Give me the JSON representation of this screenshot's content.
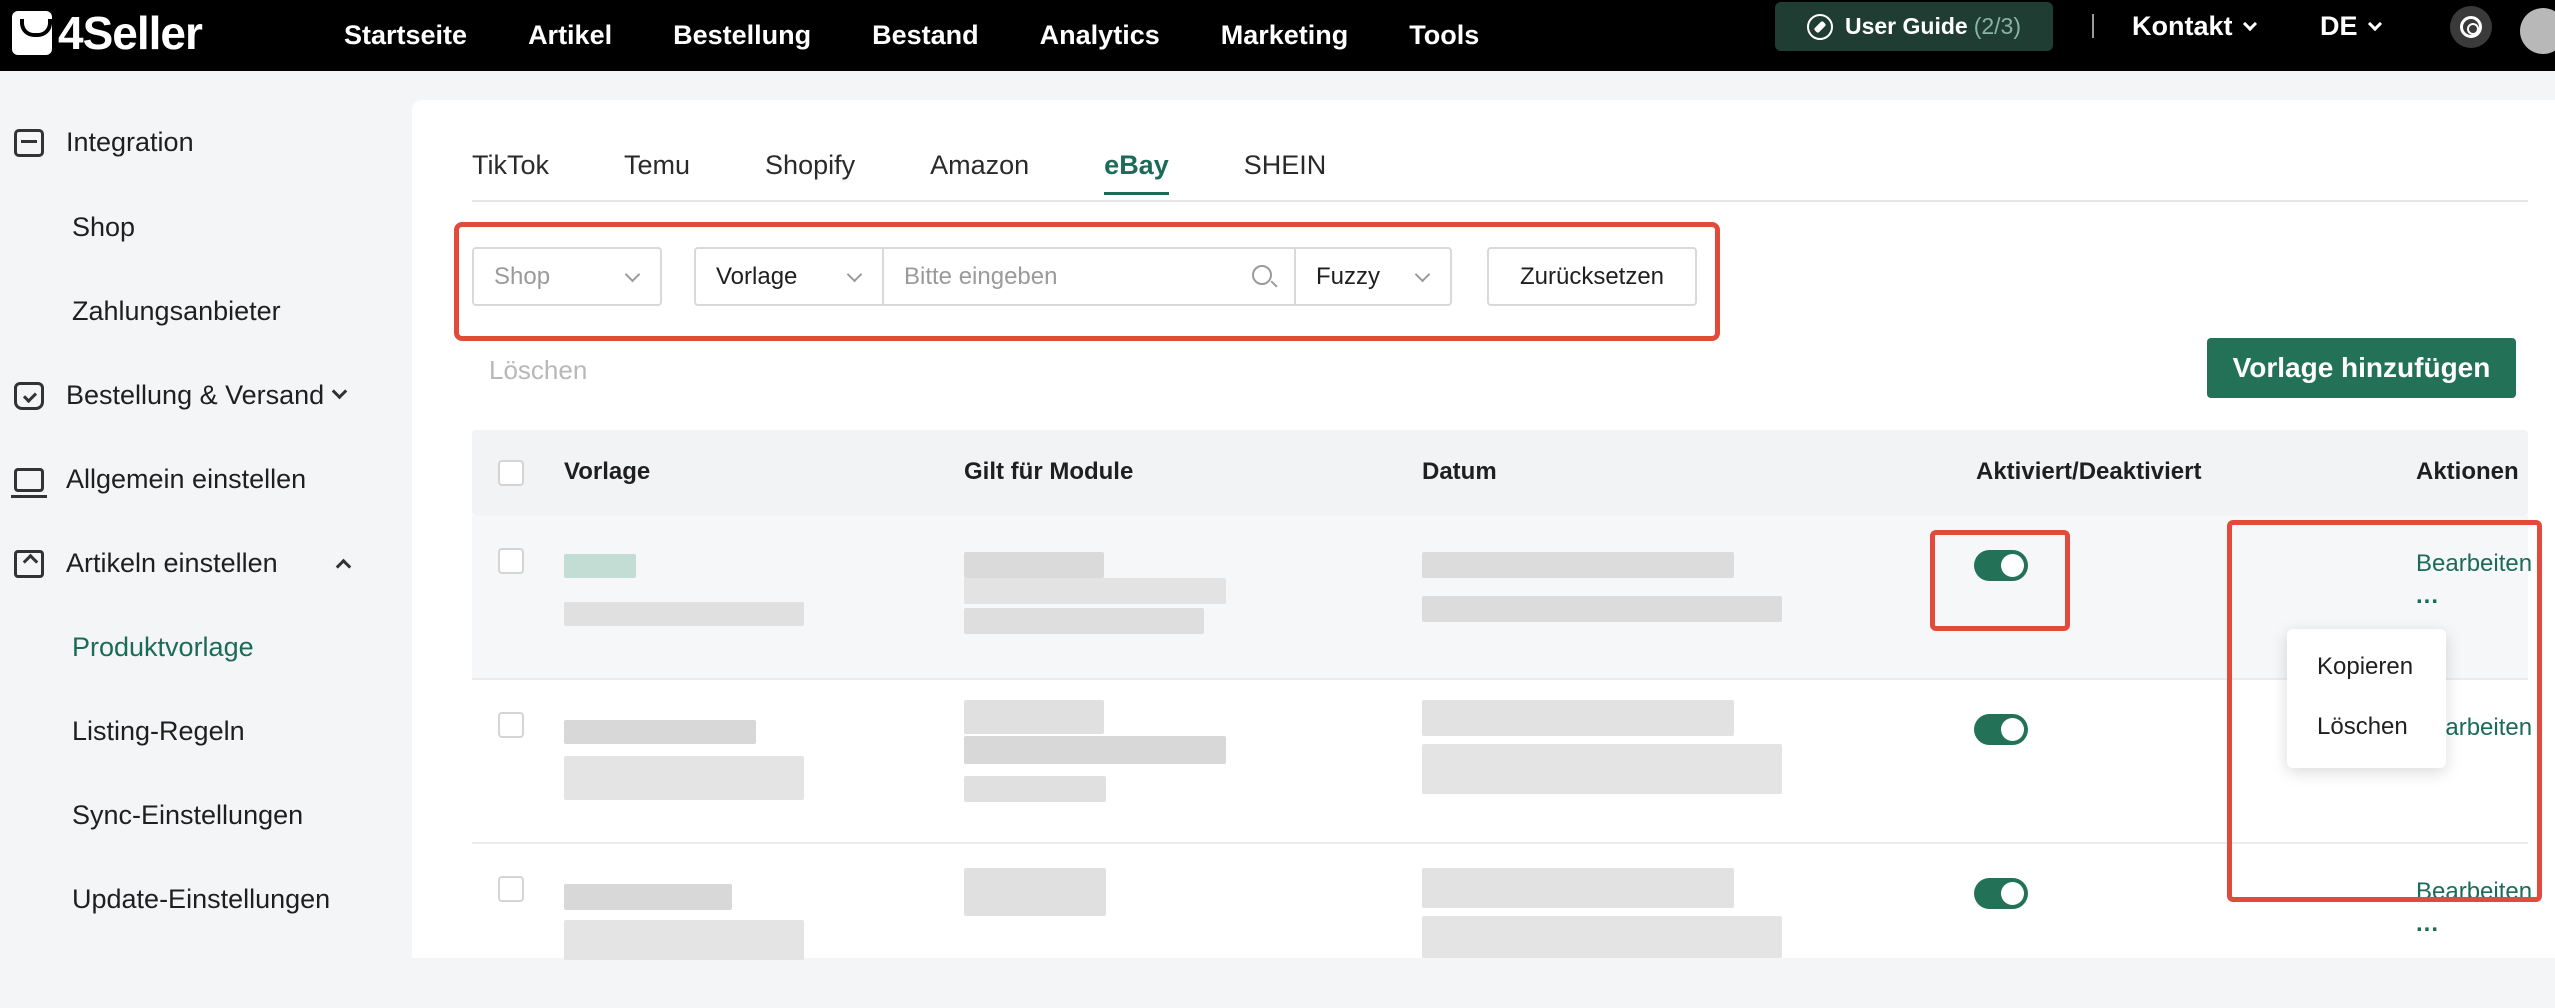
{
  "app": {
    "logo_text": "4Seller"
  },
  "topnav": {
    "items": [
      "Startseite",
      "Artikel",
      "Bestellung",
      "Bestand",
      "Analytics",
      "Marketing",
      "Tools"
    ],
    "user_guide": {
      "label": "User Guide",
      "progress": "(2/3)"
    },
    "contact": "Kontakt",
    "language": "DE"
  },
  "sidebar": {
    "integration": {
      "label": "Integration",
      "children": [
        "Shop",
        "Zahlungsanbieter"
      ]
    },
    "order_shipping": "Bestellung & Versand",
    "general_settings": "Allgemein einstellen",
    "article_settings": {
      "label": "Artikeln einstellen",
      "children": [
        "Produktvorlage",
        "Listing-Regeln",
        "Sync-Einstellungen",
        "Update-Einstellungen"
      ],
      "active": "Produktvorlage"
    }
  },
  "tabs": {
    "items": [
      "TikTok",
      "Temu",
      "Shopify",
      "Amazon",
      "eBay",
      "SHEIN"
    ],
    "active": "eBay"
  },
  "filters": {
    "shop_placeholder": "Shop",
    "template_select": "Vorlage",
    "search_placeholder": "Bitte eingeben",
    "match_mode": "Fuzzy",
    "reset_label": "Zurücksetzen"
  },
  "actions": {
    "delete_label": "Löschen",
    "add_template_label": "Vorlage hinzufügen"
  },
  "table": {
    "columns": [
      "Vorlage",
      "Gilt für Module",
      "Datum",
      "Aktiviert/Deaktiviert",
      "Aktionen"
    ],
    "rows": [
      {
        "enabled": true,
        "edit_label": "Bearbeiten",
        "more_label": "..."
      },
      {
        "enabled": true,
        "edit_label": "Bearbeiten",
        "more_label": "..."
      },
      {
        "enabled": true,
        "edit_label": "Bearbeiten",
        "more_label": "..."
      }
    ]
  },
  "dropdown_menu": {
    "items": [
      "Kopieren",
      "Löschen"
    ]
  },
  "colors": {
    "accent": "#237257",
    "highlight": "#e24a3b",
    "topbar": "#000000"
  }
}
